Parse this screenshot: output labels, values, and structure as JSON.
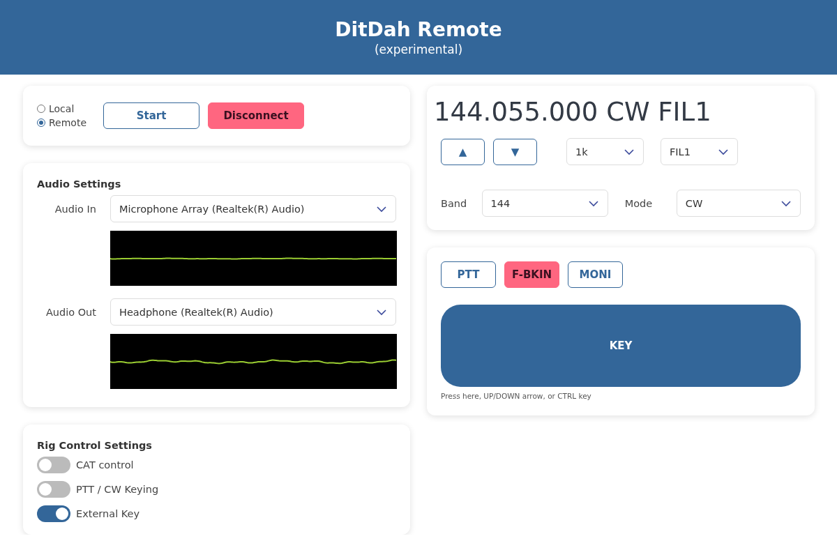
{
  "header": {
    "title": "DitDah Remote",
    "subtitle": "(experimental)"
  },
  "connection": {
    "modes": [
      {
        "label": "Local",
        "selected": false
      },
      {
        "label": "Remote",
        "selected": true
      }
    ],
    "buttons": [
      {
        "label": "Start",
        "active": false
      },
      {
        "label": "Disconnect",
        "active": true
      }
    ]
  },
  "audio": {
    "title": "Audio Settings",
    "devices": [
      {
        "label": "Audio In",
        "value": "Microphone Array (Realtek(R) Audio)"
      },
      {
        "label": "Audio Out",
        "value": "Headphone (Realtek(R) Audio)"
      }
    ]
  },
  "rig": {
    "title": "Rig Control Settings",
    "switches": [
      {
        "label": "CAT control",
        "on": false
      },
      {
        "label": "PTT / CW Keying",
        "on": false
      },
      {
        "label": "External Key",
        "on": true
      }
    ]
  },
  "radio": {
    "frequency": "144.055.000 CW FIL1",
    "step_buttons": [
      "▲",
      "▼"
    ],
    "step": "1k",
    "filter": "FIL1",
    "band": {
      "label": "Band",
      "value": "144"
    },
    "mode": {
      "label": "Mode",
      "value": "CW"
    }
  },
  "keying": {
    "toggles": [
      {
        "label": "PTT",
        "active": false
      },
      {
        "label": "F-BKIN",
        "active": true
      },
      {
        "label": "MONI",
        "active": false
      }
    ],
    "key": "KEY",
    "hint": "Press here, UP/DOWN arrow, or CTRL key"
  }
}
